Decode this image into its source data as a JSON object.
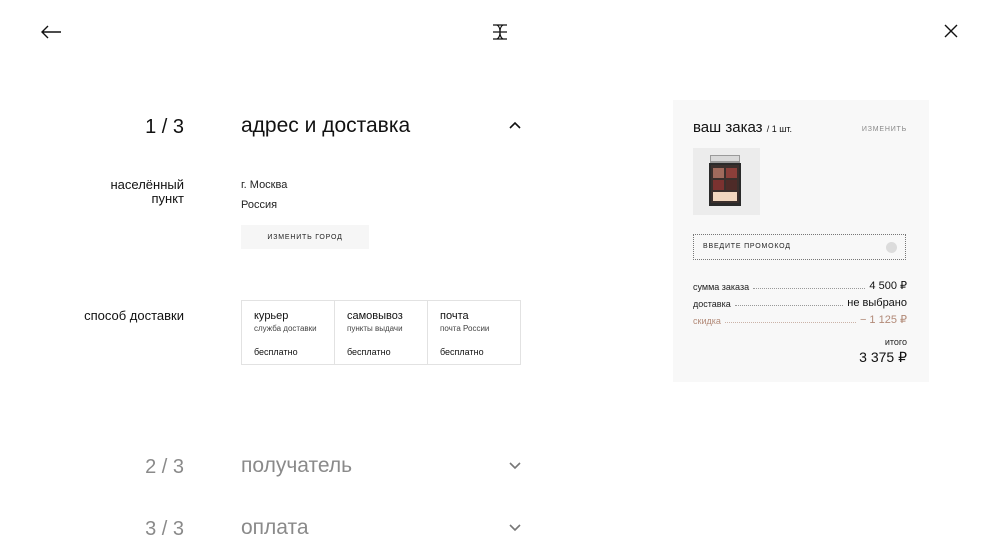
{
  "header": {
    "back_icon": "arrow-left-icon",
    "logo_icon": "brand-monogram-icon",
    "close_icon": "close-icon"
  },
  "steps": [
    {
      "number": "1 / 3",
      "title": "адрес и доставка",
      "state": "expanded",
      "chevron": "chevron-up-icon"
    },
    {
      "number": "2 / 3",
      "title": "получатель",
      "state": "collapsed",
      "chevron": "chevron-down-icon"
    },
    {
      "number": "3 / 3",
      "title": "оплата",
      "state": "collapsed",
      "chevron": "chevron-down-icon"
    }
  ],
  "address": {
    "label": "населённый пункт",
    "city": "г. Москва",
    "country": "Россия",
    "change_button": "ИЗМЕНИТЬ ГОРОД"
  },
  "delivery": {
    "label": "способ доставки",
    "options": [
      {
        "name": "курьер",
        "sub": "служба доставки",
        "price": "бесплатно"
      },
      {
        "name": "самовывоз",
        "sub": "пункты выдачи",
        "price": "бесплатно"
      },
      {
        "name": "почта",
        "sub": "почта России",
        "price": "бесплатно"
      }
    ]
  },
  "summary": {
    "title": "ваш заказ",
    "qty": "/ 1 шт.",
    "edit": "ИЗМЕНИТЬ",
    "product_icon": "eyeshadow-palette-icon",
    "promo_label": "ВВЕДИТЕ ПРОМОКОД",
    "rows": [
      {
        "key": "сумма заказа",
        "value": "4 500 ₽"
      },
      {
        "key": "доставка",
        "value": "не выбрано"
      },
      {
        "key": "скидка",
        "value": "− 1 125 ₽"
      }
    ],
    "total_label": "итого",
    "total_value": "3 375 ₽"
  },
  "colors": {
    "discount": "#b28a78",
    "panel_bg": "#f8f8f8",
    "muted_text": "#8a8a8a"
  }
}
